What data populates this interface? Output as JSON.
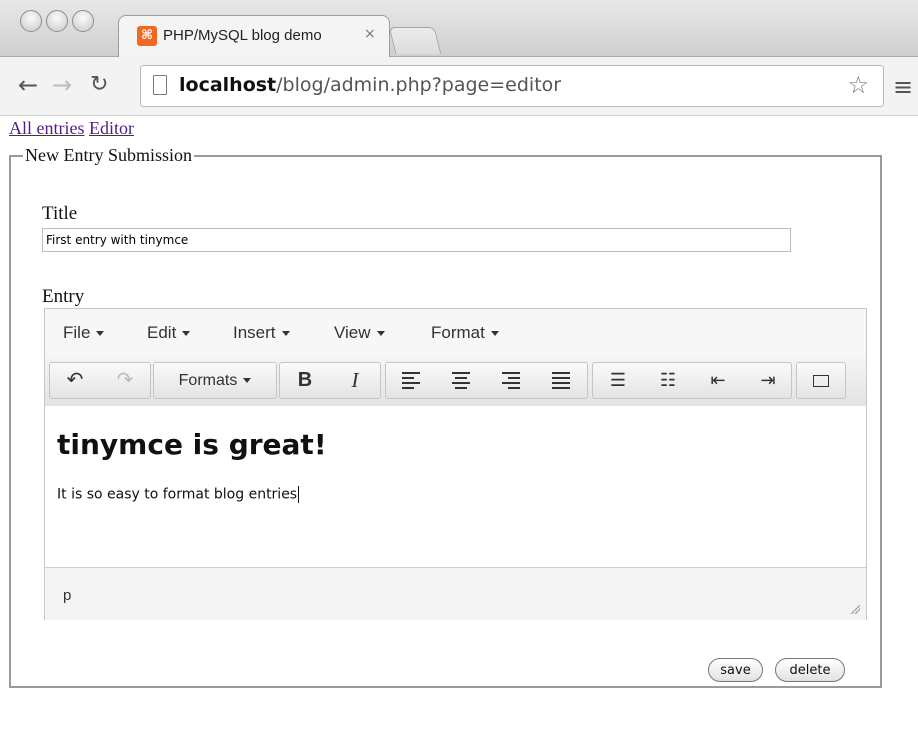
{
  "browser": {
    "tab_title": "PHP/MySQL blog demo",
    "tab_close": "×",
    "url_host": "localhost",
    "url_path": "/blog/admin.php?page=editor",
    "icons": [
      "back-arrow-icon",
      "forward-arrow-icon",
      "reload-icon",
      "page-icon",
      "star-icon",
      "menu-icon"
    ]
  },
  "nav": {
    "all_entries": "All entries",
    "editor": "Editor"
  },
  "form": {
    "legend": "New Entry Submission",
    "title_label": "Title",
    "title_value": "First entry with tinymce",
    "entry_label": "Entry",
    "save": "save",
    "delete": "delete"
  },
  "editor": {
    "menu": [
      "File",
      "Edit",
      "Insert",
      "View",
      "Format"
    ],
    "formats_label": "Formats",
    "bold": "B",
    "italic": "I",
    "heading": "tinymce is great!",
    "paragraph": "It is so easy to format blog entries",
    "path": "p"
  }
}
